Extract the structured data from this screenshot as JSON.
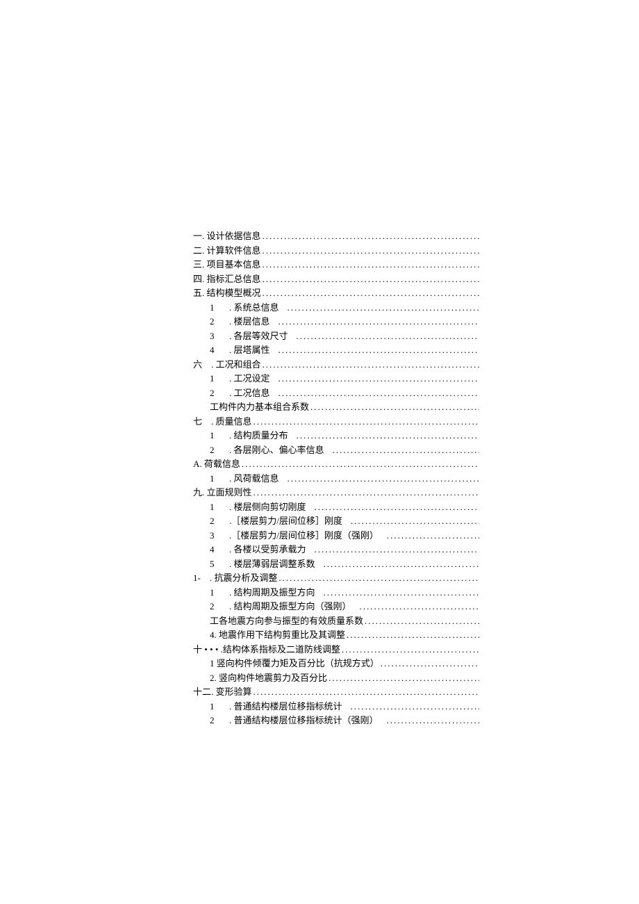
{
  "toc": {
    "s1": {
      "label": "一. 设计依据信息"
    },
    "s2": {
      "label": "二. 计算软件信息"
    },
    "s3": {
      "label": "三. 项目基本信息"
    },
    "s4": {
      "label": "四. 指标汇总信息"
    },
    "s5": {
      "label": "五. 结构模型概况",
      "c1": {
        "num": "1",
        "label": ". 系统总信息"
      },
      "c2": {
        "num": "2",
        "label": ". 楼层信息"
      },
      "c3": {
        "num": "3",
        "label": ". 各层等效尺寸"
      },
      "c4": {
        "num": "4",
        "label": ". 层塔属性"
      }
    },
    "s6": {
      "label": "六 . 工况和组合",
      "c1": {
        "num": "1",
        "label": ". 工况设定"
      },
      "c2": {
        "num": "2",
        "label": ". 工况信息"
      },
      "c3": {
        "label": "工构件内力基本组合系数"
      }
    },
    "s7": {
      "label": "七 . 质量信息",
      "c1": {
        "num": "1",
        "label": ". 结构质量分布"
      },
      "c2": {
        "num": "2",
        "label": ". 各层刚心、偏心率信息"
      }
    },
    "s8": {
      "label": "A. 荷载信息",
      "c1": {
        "num": "1",
        "label": ". 风荷载信息"
      }
    },
    "s9": {
      "label": "九. 立面规则性",
      "c1": {
        "num": "1",
        "label": ". 楼层侧向剪切刚度"
      },
      "c2": {
        "num": "2",
        "label": ".［楼层剪力/层间位移］刚度"
      },
      "c3": {
        "num": "3",
        "label": ".［楼层剪力/层间位移］刚度（强刚）"
      },
      "c4": {
        "num": "4",
        "label": ". 各楼以受剪承载力"
      },
      "c5": {
        "num": "5",
        "label": ". 楼层薄弱层调整系数"
      }
    },
    "s10": {
      "label": "1- . 抗震分析及调整",
      "c1": {
        "num": "1",
        "label": ". 结构周期及振型方向"
      },
      "c2": {
        "num": "2",
        "label": ". 结构周期及振型方向（强刚）"
      },
      "c3": {
        "label": "工各地震方向参与振型的有效质量系数"
      },
      "c4": {
        "label": "4. 地震作用下结构剪重比及其调整"
      }
    },
    "s11": {
      "label": "十 • • • .结构体系指标及二道防线调整",
      "c1": {
        "label": "1 竖向构件倾覆力矩及百分比（抗规方式）"
      },
      "c2": {
        "label": "2. 竖向构件地震剪力及百分比"
      }
    },
    "s12": {
      "label": "十二. 变形验算",
      "c1": {
        "num": "1",
        "label": ". 普通结构楼层位移指标统计"
      },
      "c2": {
        "num": "2",
        "label": ". 普通结构楼层位移指标统计（强刚）"
      }
    }
  }
}
